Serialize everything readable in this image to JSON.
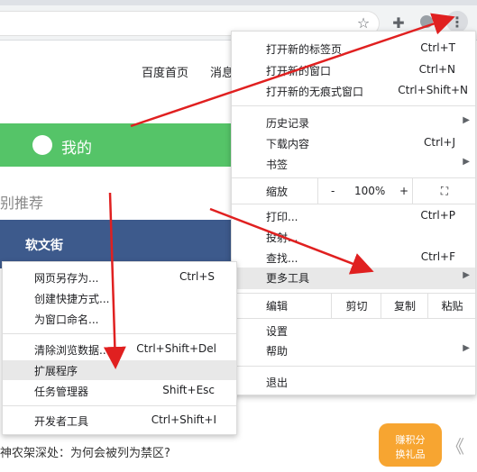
{
  "toolbar": {
    "star_icon": "star-icon",
    "ext_icon": "puzzle-icon",
    "menu_icon": "kebab-icon"
  },
  "page": {
    "nav": [
      "百度首页",
      "消息"
    ],
    "my_label": "我的",
    "rec_label": "别推荐",
    "logo_text": "软文街",
    "bottom_text": "神农架深处：为何会被列为禁区?",
    "badge_text": "赚积分\n换礼品",
    "chevron": "《"
  },
  "menu": {
    "items": [
      {
        "label": "打开新的标签页",
        "shortcut": "Ctrl+T"
      },
      {
        "label": "打开新的窗口",
        "shortcut": "Ctrl+N"
      },
      {
        "label": "打开新的无痕式窗口",
        "shortcut": "Ctrl+Shift+N"
      },
      {
        "label": "历史记录",
        "shortcut": ""
      },
      {
        "label": "下载内容",
        "shortcut": "Ctrl+J"
      },
      {
        "label": "书签",
        "shortcut": ""
      },
      {
        "label": "缩放",
        "shortcut": ""
      },
      {
        "label": "打印...",
        "shortcut": "Ctrl+P"
      },
      {
        "label": "投射...",
        "shortcut": ""
      },
      {
        "label": "查找...",
        "shortcut": "Ctrl+F"
      },
      {
        "label": "更多工具",
        "shortcut": ""
      },
      {
        "label": "编辑",
        "shortcut": ""
      },
      {
        "label": "设置",
        "shortcut": ""
      },
      {
        "label": "帮助",
        "shortcut": ""
      },
      {
        "label": "退出",
        "shortcut": ""
      }
    ],
    "zoom": {
      "minus": "-",
      "value": "100%",
      "plus": "+"
    },
    "edit": {
      "cut": "剪切",
      "copy": "复制",
      "paste": "粘贴"
    }
  },
  "submenu": {
    "items": [
      {
        "label": "网页另存为...",
        "shortcut": "Ctrl+S"
      },
      {
        "label": "创建快捷方式...",
        "shortcut": ""
      },
      {
        "label": "为窗口命名...",
        "shortcut": ""
      },
      {
        "label": "清除浏览数据...",
        "shortcut": "Ctrl+Shift+Del"
      },
      {
        "label": "扩展程序",
        "shortcut": ""
      },
      {
        "label": "任务管理器",
        "shortcut": "Shift+Esc"
      },
      {
        "label": "开发者工具",
        "shortcut": "Ctrl+Shift+I"
      }
    ]
  }
}
